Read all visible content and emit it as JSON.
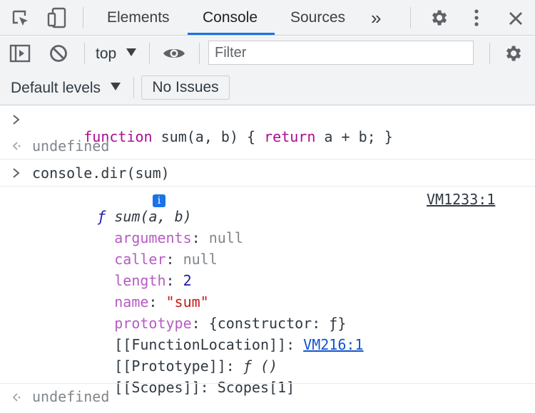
{
  "tabs": {
    "elements": "Elements",
    "console": "Console",
    "sources": "Sources",
    "more": "»"
  },
  "toolbar": {
    "context": "top",
    "filter_placeholder": "Filter"
  },
  "levels": {
    "default_levels": "Default levels",
    "no_issues": "No Issues"
  },
  "console": {
    "entry1": {
      "kw_function": "function",
      "mid": " sum(a, b) { ",
      "kw_return": "return",
      "tail": " a + b; }"
    },
    "result1": "undefined",
    "entry2": "console.dir(sum)",
    "dir": {
      "header_f": "ƒ",
      "header_sig": "sum(a, b)",
      "info": "i",
      "source_link": "VM1233:1",
      "props": {
        "arguments_key": "arguments",
        "arguments_val": "null",
        "caller_key": "caller",
        "caller_val": "null",
        "length_key": "length",
        "length_val": "2",
        "name_key": "name",
        "name_val": "\"sum\"",
        "prototype_key": "prototype",
        "prototype_val": "{constructor: ƒ}",
        "fnloc_key": "[[FunctionLocation]]",
        "fnloc_val": "VM216:1",
        "proto_key": "[[Prototype]]",
        "proto_val": "ƒ ()",
        "scopes_key": "[[Scopes]]",
        "scopes_val": "Scopes[1]"
      }
    },
    "result2": "undefined"
  },
  "colors": {
    "accent": "#1a73e8",
    "keyword": "#aa0d91",
    "property": "#b65cc4",
    "number": "#1a1aa6",
    "string": "#c41a16",
    "link": "#1155cc"
  }
}
